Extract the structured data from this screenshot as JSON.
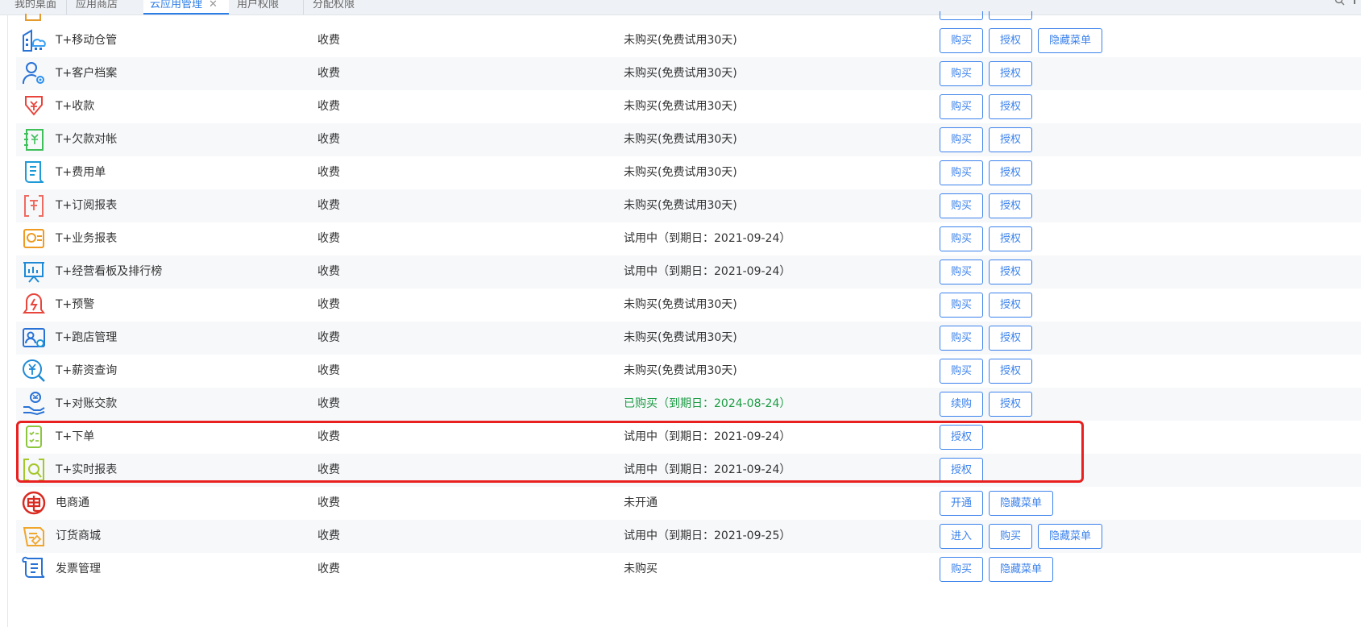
{
  "tabs": [
    {
      "label": "我的桌面"
    },
    {
      "label": "应用商店"
    },
    {
      "label": "云应用管理",
      "active": true
    },
    {
      "label": "用户权限"
    },
    {
      "label": "分配权限"
    }
  ],
  "tab_close_glyph": "✕",
  "apps": [
    {
      "name": "T+移动仓管",
      "icon": "warehouse-cloud-icon",
      "charge": "收费",
      "status": "未购买(免费试用30天)",
      "buttons": [
        "购买",
        "授权",
        "隐藏菜单"
      ]
    },
    {
      "name": "T+客户档案",
      "icon": "customer-profile-icon",
      "charge": "收费",
      "status": "未购买(免费试用30天)",
      "buttons": [
        "购买",
        "授权"
      ]
    },
    {
      "name": "T+收款",
      "icon": "receive-payment-icon",
      "charge": "收费",
      "status": "未购买(免费试用30天)",
      "buttons": [
        "购买",
        "授权"
      ]
    },
    {
      "name": "T+欠款对帐",
      "icon": "debt-reconcile-icon",
      "charge": "收费",
      "status": "未购买(免费试用30天)",
      "buttons": [
        "购买",
        "授权"
      ]
    },
    {
      "name": "T+费用单",
      "icon": "expense-bill-icon",
      "charge": "收费",
      "status": "未购买(免费试用30天)",
      "buttons": [
        "购买",
        "授权"
      ]
    },
    {
      "name": "T+订阅报表",
      "icon": "subscription-report-icon",
      "charge": "收费",
      "status": "未购买(免费试用30天)",
      "buttons": [
        "购买",
        "授权"
      ]
    },
    {
      "name": "T+业务报表",
      "icon": "business-report-icon",
      "charge": "收费",
      "status": "试用中（到期日：2021-09-24）",
      "buttons": [
        "购买",
        "授权"
      ]
    },
    {
      "name": "T+经营看板及排行榜",
      "icon": "dashboard-board-icon",
      "charge": "收费",
      "status": "试用中（到期日：2021-09-24）",
      "buttons": [
        "购买",
        "授权"
      ]
    },
    {
      "name": "T+预警",
      "icon": "alert-bell-icon",
      "charge": "收费",
      "status": "未购买(免费试用30天)",
      "buttons": [
        "购买",
        "授权"
      ]
    },
    {
      "name": "T+跑店管理",
      "icon": "store-visit-icon",
      "charge": "收费",
      "status": "未购买(免费试用30天)",
      "buttons": [
        "购买",
        "授权"
      ]
    },
    {
      "name": "T+薪资查询",
      "icon": "salary-search-icon",
      "charge": "收费",
      "status": "未购买(免费试用30天)",
      "buttons": [
        "购买",
        "授权"
      ]
    },
    {
      "name": "T+对账交款",
      "icon": "reconcile-payment-icon",
      "charge": "收费",
      "status": "已购买（到期日：2024-08-24）",
      "status_color": "#1a9c43",
      "buttons": [
        "续购",
        "授权"
      ]
    },
    {
      "name": "T+下单",
      "icon": "place-order-icon",
      "charge": "收费",
      "status": "试用中（到期日：2021-09-24）",
      "buttons": [
        "授权"
      ]
    },
    {
      "name": "T+实时报表",
      "icon": "realtime-report-icon",
      "charge": "收费",
      "status": "试用中（到期日：2021-09-24）",
      "buttons": [
        "授权"
      ]
    },
    {
      "name": "电商通",
      "icon": "ecommerce-icon",
      "charge": "收费",
      "status": "未开通",
      "buttons": [
        "开通",
        "隐藏菜单"
      ]
    },
    {
      "name": "订货商城",
      "icon": "order-mall-icon",
      "charge": "收费",
      "status": "试用中（到期日：2021-09-25）",
      "buttons": [
        "进入",
        "购买",
        "隐藏菜单"
      ]
    },
    {
      "name": "发票管理",
      "icon": "invoice-icon",
      "charge": "收费",
      "status": "未购买",
      "buttons": [
        "购买",
        "隐藏菜单"
      ]
    }
  ],
  "colors": {
    "accent": "#3c82ec",
    "highlight": "#e8201f",
    "purchased": "#1a9c43"
  }
}
